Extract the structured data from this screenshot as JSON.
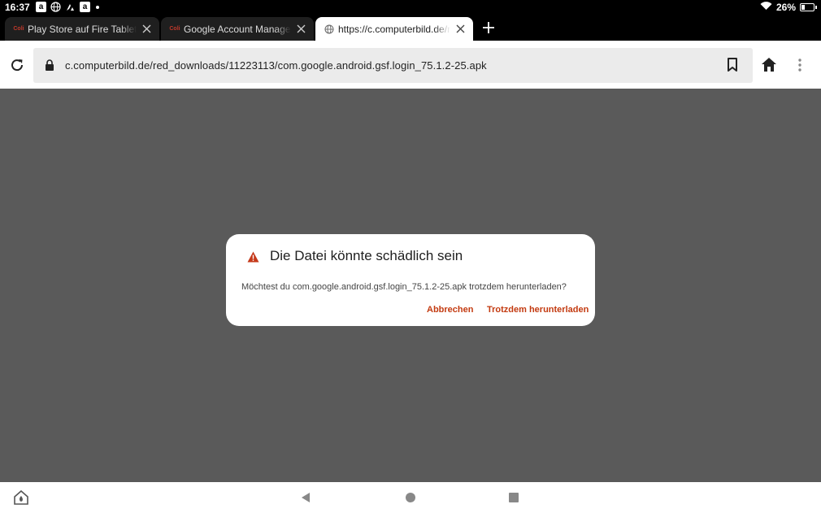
{
  "status_bar": {
    "time": "16:37",
    "battery": "26%",
    "battery_level": 0.26,
    "icons": [
      "amazon-icon",
      "globe-icon",
      "kindle-icon",
      "amazon-icon",
      "notification-dot",
      "wifi-icon",
      "battery-icon"
    ]
  },
  "tabs": [
    {
      "favicon": "Coli",
      "title": "Play Store auf Fire Tablet installieren"
    },
    {
      "favicon": "Coli",
      "title": "Google Account Manager (APK)"
    },
    {
      "favicon": "globe-icon",
      "title": "https://c.computerbild.de/red_downloads"
    }
  ],
  "toolbar": {
    "url": "c.computerbild.de/red_downloads/11223113/com.google.android.gsf.login_75.1.2-25.apk"
  },
  "dialog": {
    "title": "Die Datei könnte schädlich sein",
    "message": "Möchtest du com.google.android.gsf.login_75.1.2-25.apk trotzdem herunterladen?",
    "cancel_label": "Abbrechen",
    "confirm_label": "Trotzdem herunterladen",
    "accent_color": "#c33a10",
    "warning_color": "#c5391a"
  },
  "colors": {
    "page_background": "#5a5a5a",
    "tab_strip": "#000000"
  }
}
